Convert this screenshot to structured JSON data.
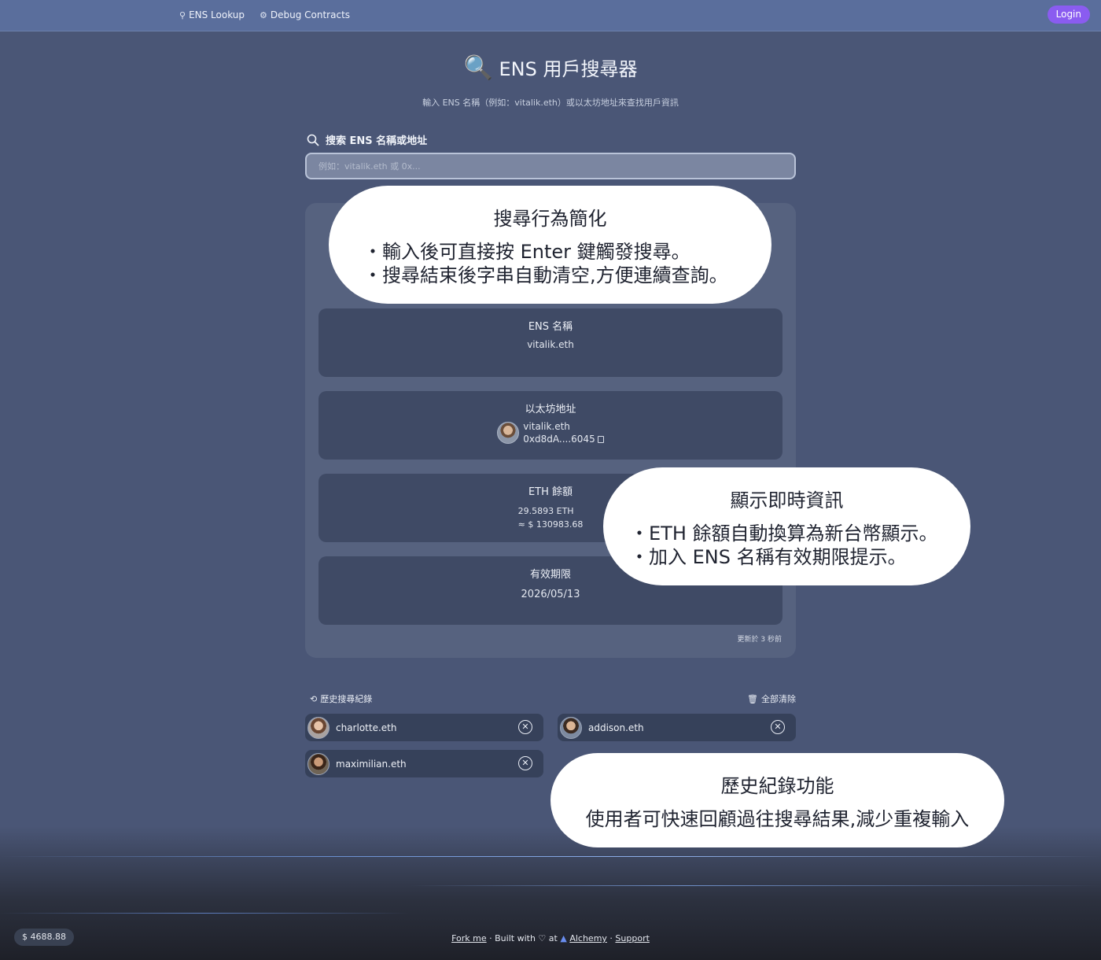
{
  "nav": {
    "lookup_label": "ENS Lookup",
    "debug_label": "Debug Contracts",
    "login_label": "Login"
  },
  "header": {
    "title": "ENS 用戶搜尋器",
    "subtitle": "輸入 ENS 名稱（例如：vitalik.eth）或以太坊地址來查找用戶資訊"
  },
  "search": {
    "label": "搜索 ENS 名稱或地址",
    "placeholder": "例如：vitalik.eth 或 0x...",
    "value": ""
  },
  "result": {
    "ens_title": "ENS 名稱",
    "ens_value": "vitalik.eth",
    "address_title": "以太坊地址",
    "address_name": "vitalik.eth",
    "address_short": "0xd8dA....6045",
    "balance_title": "ETH 餘額",
    "balance_eth": "29.5893 ETH",
    "balance_fiat": "≈ $ 130983.68",
    "expiry_title": "有效期限",
    "expiry_value": "2026/05/13",
    "updated": "更新於 3 秒前"
  },
  "history": {
    "title": "歷史搜尋紀錄",
    "clear_label": "全部清除",
    "items": [
      {
        "name": "charlotte.eth"
      },
      {
        "name": "addison.eth"
      },
      {
        "name": "maximilian.eth"
      }
    ]
  },
  "callouts": {
    "search": {
      "title": "搜尋行為簡化",
      "line1": "・輸入後可直接按 Enter 鍵觸發搜尋。",
      "line2": "・搜尋結束後字串自動清空,方便連續查詢。"
    },
    "info": {
      "title": "顯示即時資訊",
      "line1": "・ETH 餘額自動換算為新台幣顯示。",
      "line2": "・加入 ENS 名稱有效期限提示。"
    },
    "history": {
      "title": "歷史紀錄功能",
      "line1": "使用者可快速回顧過往搜尋結果,減少重複輸入"
    }
  },
  "footer": {
    "balance": "4688.88",
    "fork": "Fork me",
    "built": "· Built with",
    "at": "at",
    "alchemy": "Alchemy",
    "support": "Support"
  },
  "colors": {
    "nav_bg": "#5a6e9c",
    "page_bg": "#4a5676",
    "login_accent": "#8a5cf0"
  }
}
